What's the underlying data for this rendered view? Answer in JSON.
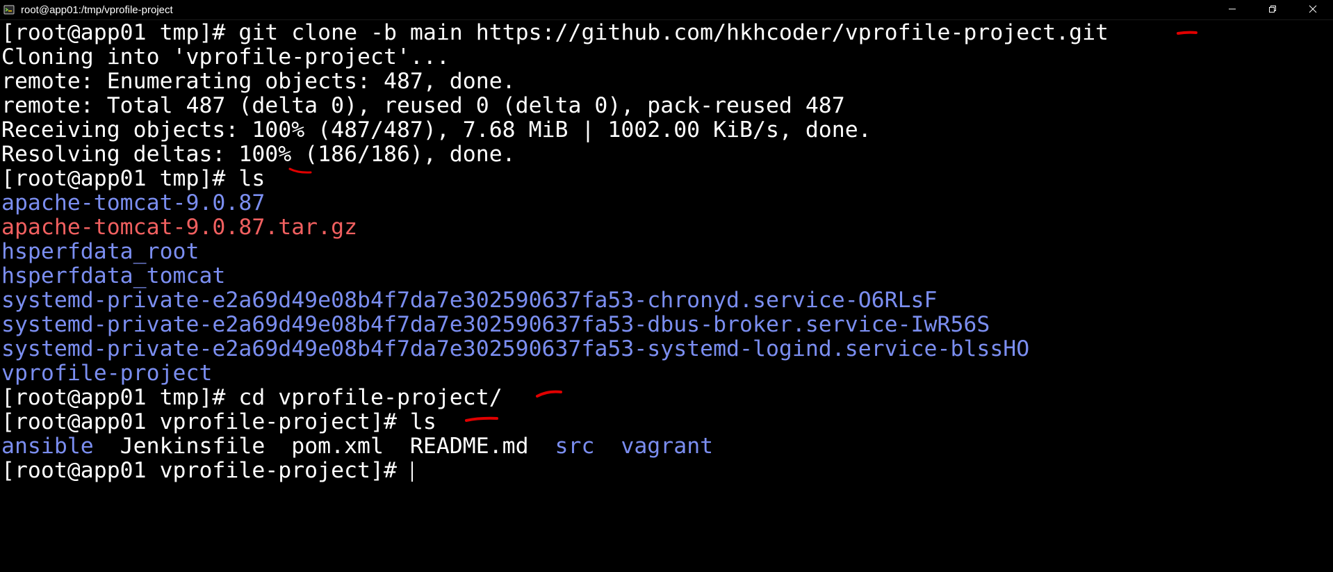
{
  "window": {
    "title": "root@app01:/tmp/vprofile-project",
    "icons": {
      "app": "terminal-app-icon",
      "minimize": "minimize-icon",
      "restore": "restore-icon",
      "close": "close-icon"
    }
  },
  "colors": {
    "background": "#000000",
    "text": "#ffffff",
    "directory": "#7b8ef0",
    "archive": "#f16060",
    "annotation": "#e00000"
  },
  "terminal": {
    "lines": [
      {
        "segments": [
          {
            "text": "[root@app01 tmp]# git clone -b main https://github.com/hkhcoder/vprofile-project.git",
            "color": "white"
          }
        ]
      },
      {
        "segments": [
          {
            "text": "Cloning into 'vprofile-project'...",
            "color": "white"
          }
        ]
      },
      {
        "segments": [
          {
            "text": "remote: Enumerating objects: 487, done.",
            "color": "white"
          }
        ]
      },
      {
        "segments": [
          {
            "text": "remote: Total 487 (delta 0), reused 0 (delta 0), pack-reused 487",
            "color": "white"
          }
        ]
      },
      {
        "segments": [
          {
            "text": "Receiving objects: 100% (487/487), 7.68 MiB | 1002.00 KiB/s, done.",
            "color": "white"
          }
        ]
      },
      {
        "segments": [
          {
            "text": "Resolving deltas: 100% (186/186), done.",
            "color": "white"
          }
        ]
      },
      {
        "segments": [
          {
            "text": "[root@app01 tmp]# ls",
            "color": "white"
          }
        ]
      },
      {
        "segments": [
          {
            "text": "apache-tomcat-9.0.87",
            "color": "blue"
          }
        ]
      },
      {
        "segments": [
          {
            "text": "apache-tomcat-9.0.87.tar.gz",
            "color": "red"
          }
        ]
      },
      {
        "segments": [
          {
            "text": "hsperfdata_root",
            "color": "blue"
          }
        ]
      },
      {
        "segments": [
          {
            "text": "hsperfdata_tomcat",
            "color": "blue"
          }
        ]
      },
      {
        "segments": [
          {
            "text": "systemd-private-e2a69d49e08b4f7da7e302590637fa53-chronyd.service-O6RLsF",
            "color": "blue"
          }
        ]
      },
      {
        "segments": [
          {
            "text": "systemd-private-e2a69d49e08b4f7da7e302590637fa53-dbus-broker.service-IwR56S",
            "color": "blue"
          }
        ]
      },
      {
        "segments": [
          {
            "text": "systemd-private-e2a69d49e08b4f7da7e302590637fa53-systemd-logind.service-blssHO",
            "color": "blue"
          }
        ]
      },
      {
        "segments": [
          {
            "text": "vprofile-project",
            "color": "blue"
          }
        ]
      },
      {
        "segments": [
          {
            "text": "[root@app01 tmp]# cd vprofile-project/",
            "color": "white"
          }
        ]
      },
      {
        "segments": [
          {
            "text": "[root@app01 vprofile-project]# ls",
            "color": "white"
          }
        ]
      },
      {
        "segments": [
          {
            "text": "ansible",
            "color": "blue"
          },
          {
            "text": "  Jenkinsfile  pom.xml  README.md  ",
            "color": "white"
          },
          {
            "text": "src",
            "color": "blue"
          },
          {
            "text": "  ",
            "color": "white"
          },
          {
            "text": "vagrant",
            "color": "blue"
          }
        ]
      },
      {
        "segments": [
          {
            "text": "[root@app01 vprofile-project]# ",
            "color": "white"
          }
        ],
        "cursor": true
      }
    ]
  }
}
